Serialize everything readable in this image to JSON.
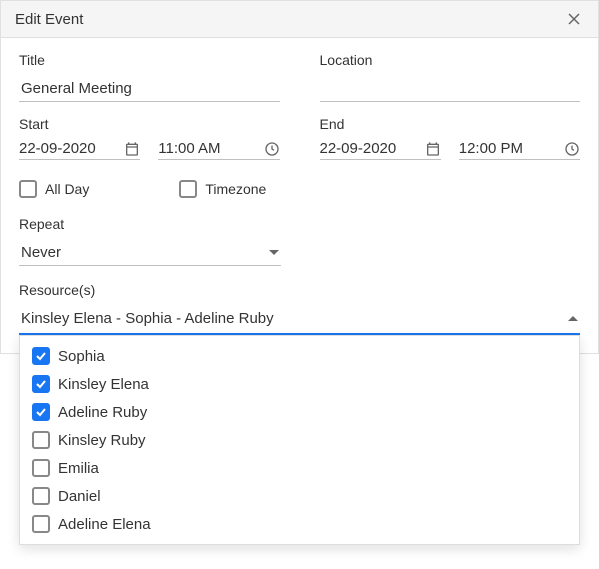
{
  "dialog": {
    "title": "Edit Event"
  },
  "fields": {
    "title_label": "Title",
    "title_value": "General Meeting",
    "location_label": "Location",
    "location_value": "",
    "start_label": "Start",
    "end_label": "End",
    "start_date": "22-09-2020",
    "start_time": "11:00 AM",
    "end_date": "22-09-2020",
    "end_time": "12:00 PM",
    "allday_label": "All Day",
    "timezone_label": "Timezone",
    "repeat_label": "Repeat",
    "repeat_value": "Never",
    "resources_label": "Resource(s)",
    "resources_value": "Kinsley Elena - Sophia - Adeline Ruby"
  },
  "resource_options": [
    {
      "label": "Sophia",
      "checked": true
    },
    {
      "label": "Kinsley Elena",
      "checked": true
    },
    {
      "label": "Adeline Ruby",
      "checked": true
    },
    {
      "label": "Kinsley Ruby",
      "checked": false
    },
    {
      "label": "Emilia",
      "checked": false
    },
    {
      "label": "Daniel",
      "checked": false
    },
    {
      "label": "Adeline Elena",
      "checked": false
    }
  ]
}
